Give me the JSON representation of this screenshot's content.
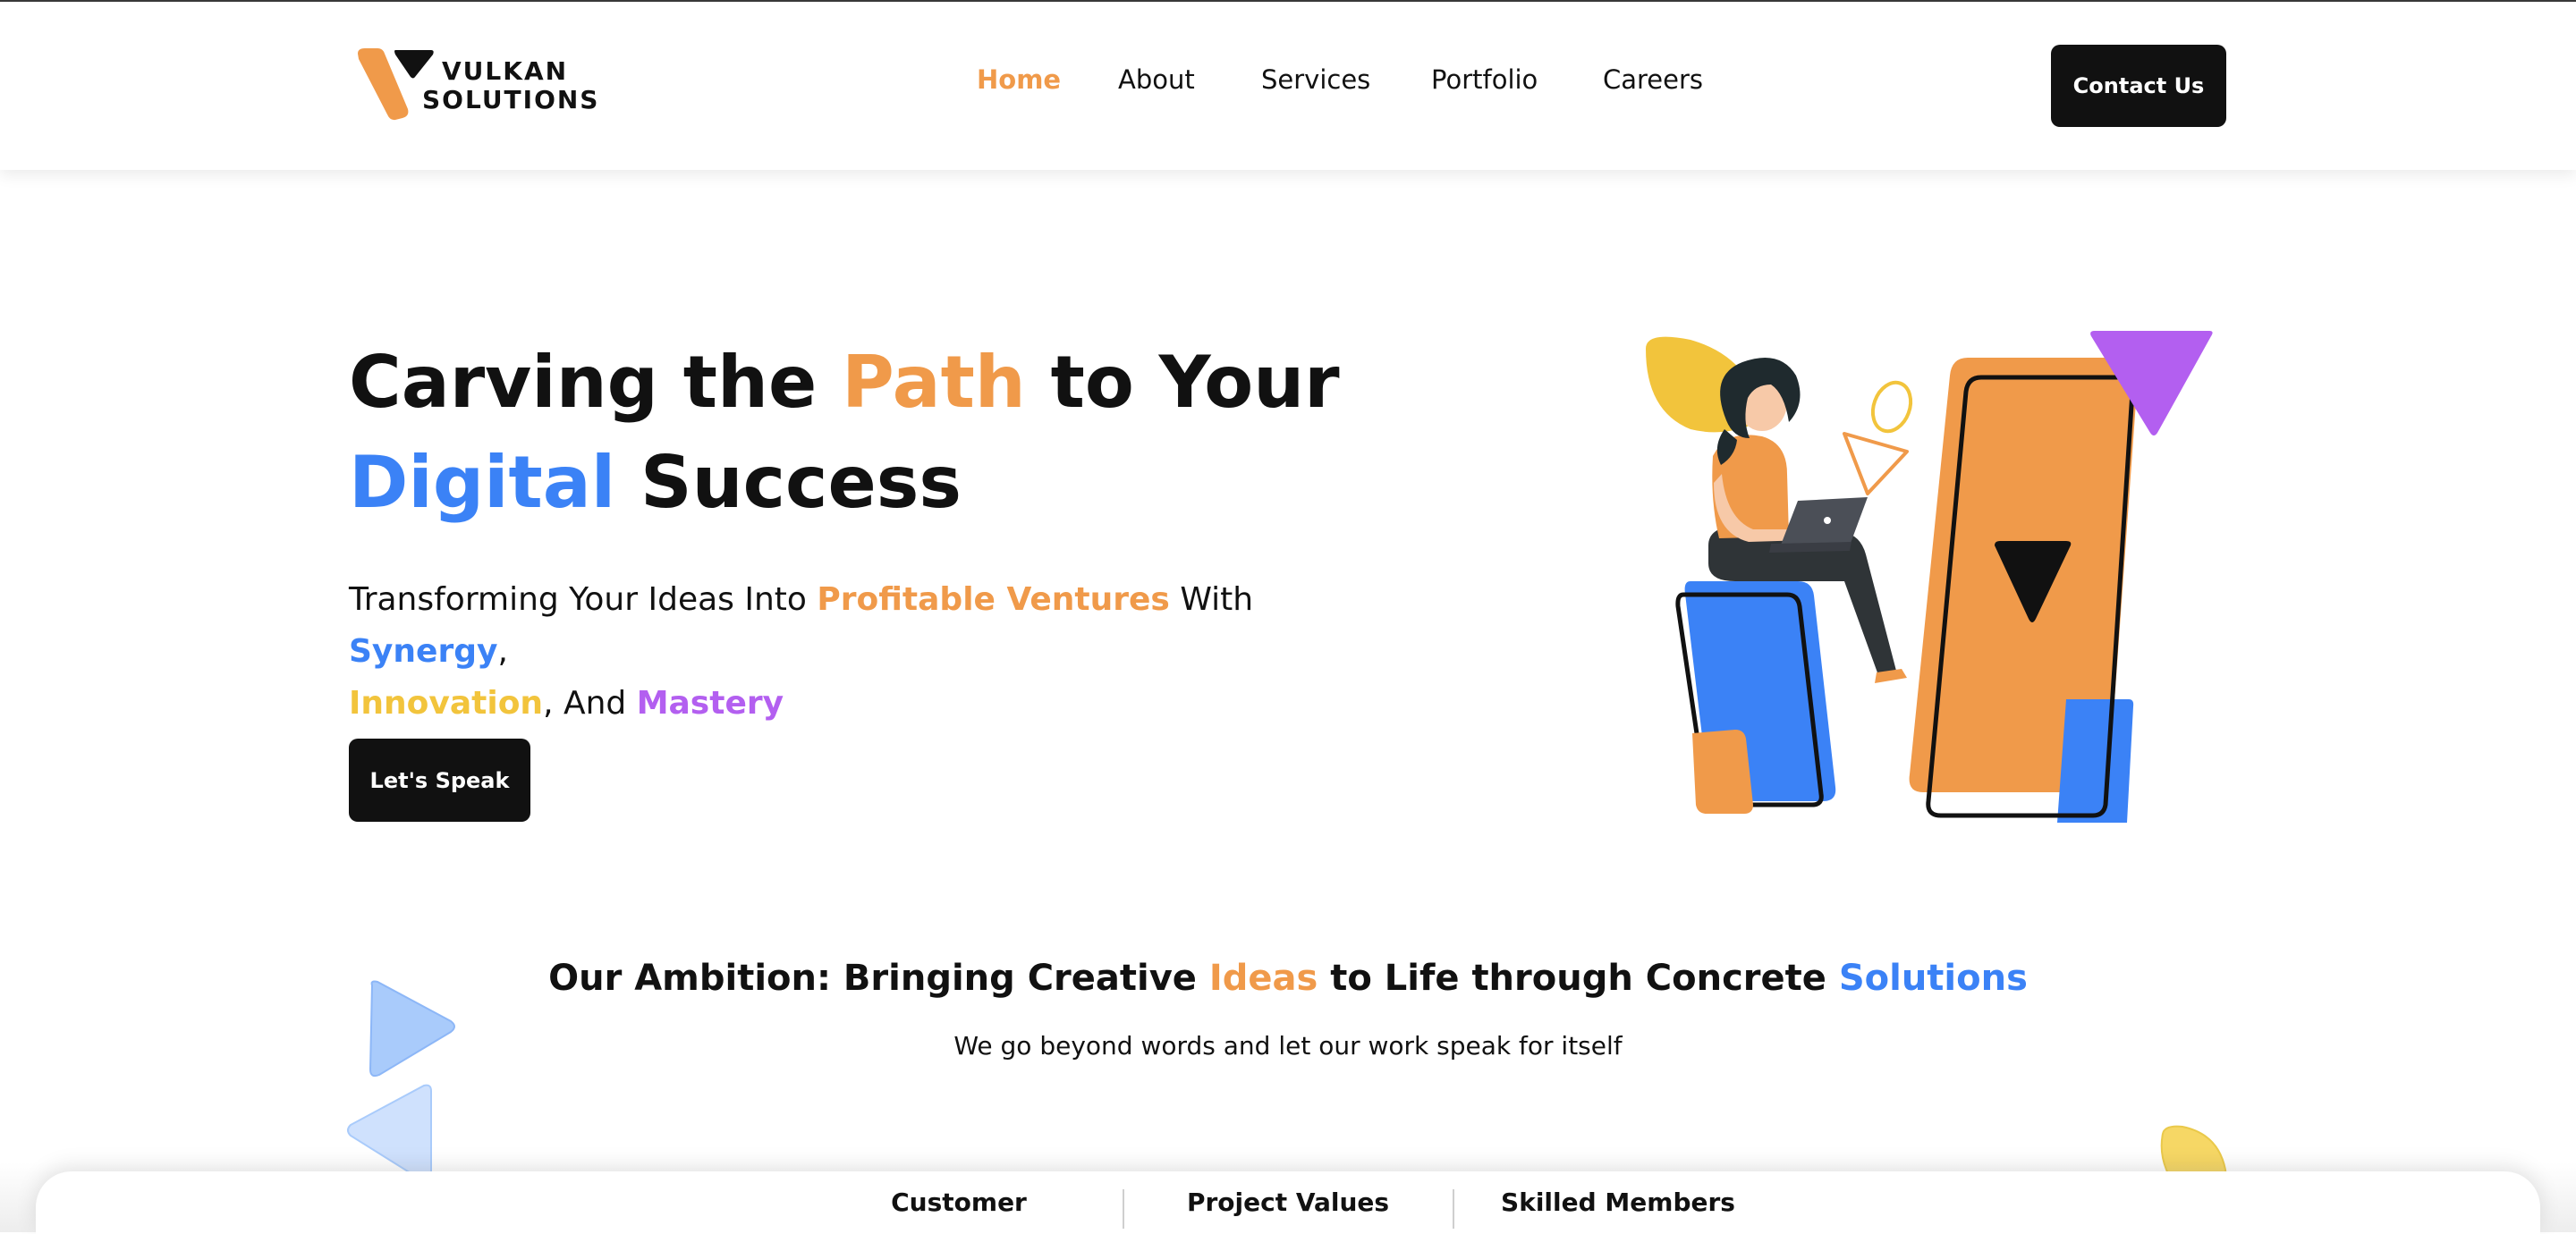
{
  "brand": {
    "line1": "VULKAN",
    "line2": "SOLUTIONS",
    "colors": {
      "orange": "#f09a4a",
      "black": "#111111",
      "blue": "#3b82f6",
      "yellow": "#f2c43c",
      "purple": "#b35ff0"
    }
  },
  "nav": {
    "items": [
      {
        "label": "Home",
        "active": true
      },
      {
        "label": "About"
      },
      {
        "label": "Services"
      },
      {
        "label": "Portfolio"
      },
      {
        "label": "Careers"
      }
    ],
    "contact_label": "Contact Us"
  },
  "hero": {
    "title": {
      "p1": "Carving the ",
      "p2": "Path",
      "p3": " to Your",
      "p4": "Digital",
      "p5": " Success"
    },
    "subtitle": {
      "p1": "Transforming Your Ideas Into ",
      "p2": "Profitable Ventures",
      "p3": " With ",
      "p4": "Synergy",
      "p5": ",",
      "p6": "Innovation",
      "p7": ", And ",
      "p8": "Mastery"
    },
    "cta_label": "Let's Speak",
    "illustration_icon": "woman-with-laptop-illustration"
  },
  "ambition": {
    "heading": {
      "p1": "Our Ambition: Bringing Creative ",
      "p2": "Ideas",
      "p3": " to Life through Concrete ",
      "p4": "Solutions"
    },
    "subtext": "We go beyond words and let our work speak for itself"
  },
  "stats": {
    "labels": [
      "Customer",
      "Project Values",
      "Skilled Members"
    ]
  }
}
